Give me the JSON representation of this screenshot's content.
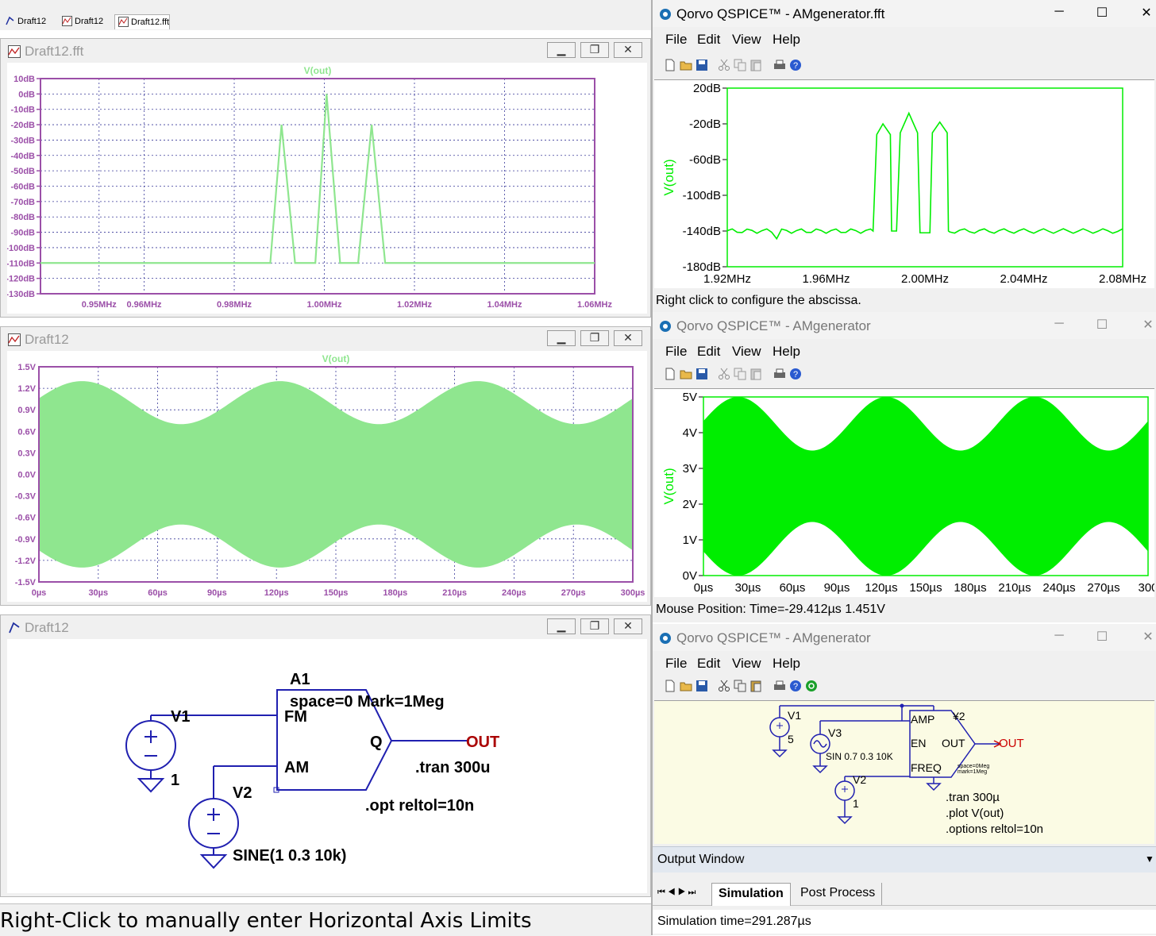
{
  "ltspice": {
    "tabs": [
      {
        "label": "Draft12",
        "icon": "schematic-icon"
      },
      {
        "label": "Draft12",
        "icon": "waveform-icon"
      },
      {
        "label": "Draft12.fft",
        "icon": "waveform-icon"
      }
    ],
    "fft_window": {
      "title": "Draft12.fft",
      "trace": "V(out)",
      "y_ticks": [
        "10dB",
        "0dB",
        "-10dB",
        "-20dB",
        "-30dB",
        "-40dB",
        "-50dB",
        "-60dB",
        "-70dB",
        "-80dB",
        "-90dB",
        "-100dB",
        "-110dB",
        "-120dB",
        "-130dB"
      ],
      "x_ticks": [
        "0.95MHz",
        "0.96MHz",
        "0.98MHz",
        "1.00MHz",
        "1.02MHz",
        "1.04MHz",
        "1.06MHz"
      ]
    },
    "tran_window": {
      "title": "Draft12",
      "trace": "V(out)",
      "y_ticks": [
        "1.5V",
        "1.2V",
        "0.9V",
        "0.6V",
        "0.3V",
        "0.0V",
        "-0.3V",
        "-0.6V",
        "-0.9V",
        "-1.2V",
        "-1.5V"
      ],
      "x_ticks": [
        "0µs",
        "30µs",
        "60µs",
        "90µs",
        "120µs",
        "150µs",
        "180µs",
        "210µs",
        "240µs",
        "270µs",
        "300µs"
      ]
    },
    "schematic_window": {
      "title": "Draft12",
      "labels": {
        "a1": "A1",
        "a1_params": "space=0 Mark=1Meg",
        "fm": "FM",
        "am": "AM",
        "q": "Q",
        "out": "OUT",
        "v1": "V1",
        "v1_value": "1",
        "v2": "V2",
        "v2_value": "SINE(1 0.3 10k)",
        "tran": ".tran 300u",
        "opt": ".opt reltol=10n"
      }
    },
    "status": "Right-Click to manually enter Horizontal Axis Limits"
  },
  "qspice": {
    "menu": [
      "File",
      "Edit",
      "View",
      "Help"
    ],
    "fft_window": {
      "title": "Qorvo QSPICE™ - AMgenerator.fft",
      "y_label": "V(out)",
      "y_ticks": [
        "20dB",
        "-20dB",
        "-60dB",
        "-100dB",
        "-140dB",
        "-180dB"
      ],
      "x_ticks": [
        "1.92MHz",
        "1.96MHz",
        "2.00MHz",
        "2.04MHz",
        "2.08MHz"
      ],
      "status": "Right click to configure the abscissa."
    },
    "tran_window": {
      "title": "Qorvo QSPICE™ - AMgenerator",
      "y_label": "V(out)",
      "y_ticks": [
        "5V",
        "4V",
        "3V",
        "2V",
        "1V",
        "0V"
      ],
      "x_ticks": [
        "0µs",
        "30µs",
        "60µs",
        "90µs",
        "120µs",
        "150µs",
        "180µs",
        "210µs",
        "240µs",
        "270µs",
        "300"
      ],
      "status": "Mouse Position: Time=-29.412µs  1.451V"
    },
    "schematic_window": {
      "title": "Qorvo QSPICE™ - AMgenerator",
      "labels": {
        "v1": "V1",
        "v1_value": "5",
        "v3": "V3",
        "v3_value": "SIN 0.7 0.3 10K",
        "v2": "V2",
        "v2_value": "1",
        "y2": "¥2",
        "amp": "AMP",
        "en": "EN",
        "freq": "FREQ",
        "out_pin": "OUT",
        "out_net": "OUT",
        "params1": "space=0Meg",
        "params2": "mark=1Meg",
        "tran": ".tran 300µ",
        "plot": ".plot V(out)",
        "options": ".options reltol=10n"
      },
      "output_window": "Output Window",
      "output_tabs": [
        "Simulation",
        "Post Process"
      ],
      "status": "Simulation time=291.287µs"
    }
  },
  "colors": {
    "lt_trace": "#8fe68f",
    "lt_frame": "#9b4fa8",
    "qs_trace": "#00ee00",
    "wire": "#2020b0",
    "out_label": "#aa0000"
  }
}
